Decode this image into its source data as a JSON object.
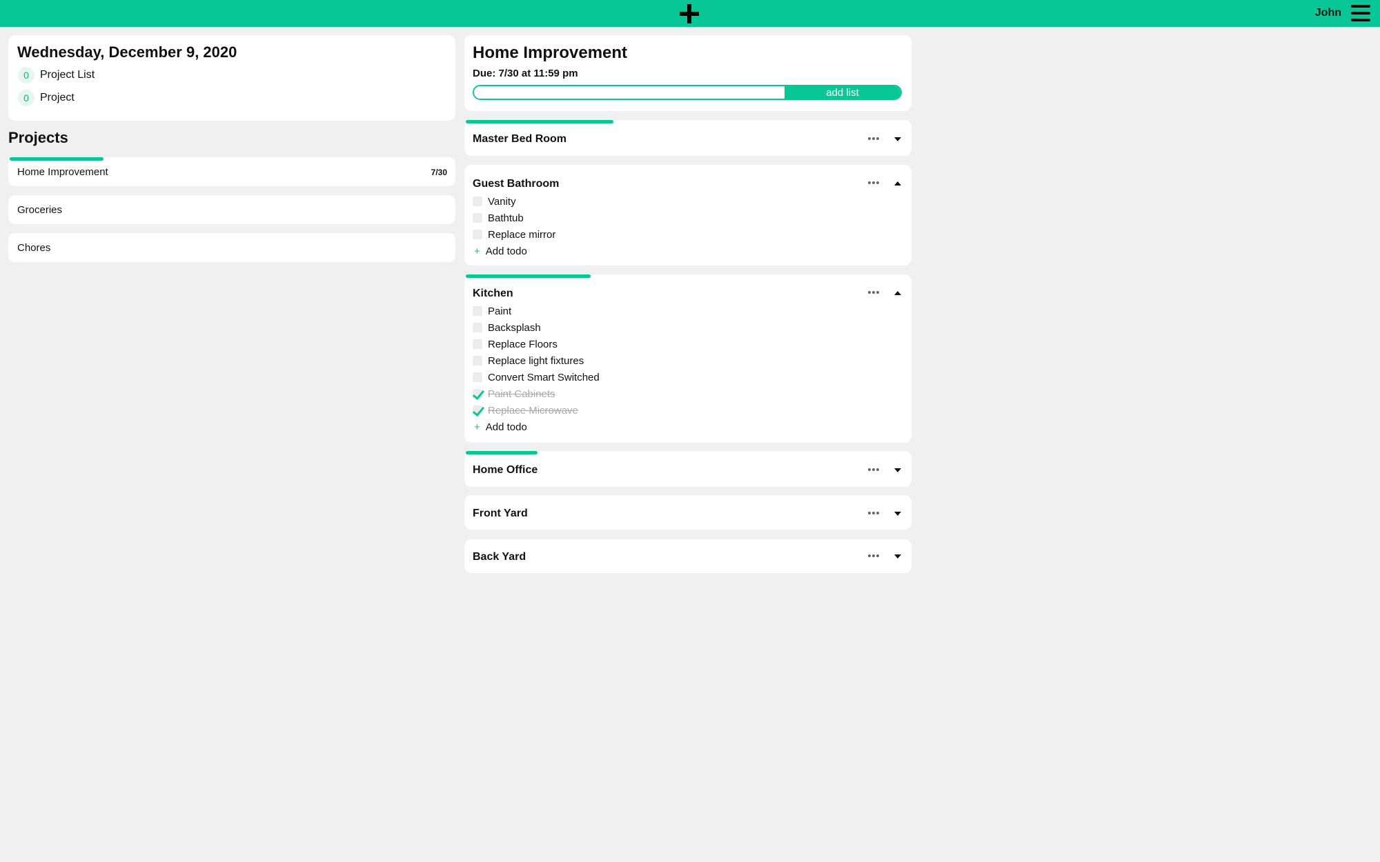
{
  "header": {
    "add_icon": "plus-icon",
    "username": "John",
    "menu_icon": "hamburger-icon",
    "accent_color": "#08c796"
  },
  "today": {
    "date": "Wednesday, December 9, 2020",
    "stats": [
      {
        "count": "0",
        "label": "Project List"
      },
      {
        "count": "0",
        "label": "Project"
      }
    ]
  },
  "projects": {
    "heading": "Projects",
    "items": [
      {
        "name": "Home Improvement",
        "due": "7/30",
        "progress": 0.21
      },
      {
        "name": "Groceries",
        "due": "",
        "progress": 0
      },
      {
        "name": "Chores",
        "due": "",
        "progress": 0
      }
    ]
  },
  "detail": {
    "title": "Home Improvement",
    "due": "Due: 7/30 at 11:59 pm",
    "add_list_value": "",
    "add_list_button": "add list"
  },
  "lists": [
    {
      "title": "Master Bed Room",
      "expanded": false,
      "progress": 0.33,
      "todos": []
    },
    {
      "title": "Guest Bathroom",
      "expanded": true,
      "progress": 0,
      "todos": [
        {
          "text": "Vanity",
          "done": false
        },
        {
          "text": "Bathtub",
          "done": false
        },
        {
          "text": "Replace mirror",
          "done": false
        }
      ]
    },
    {
      "title": "Kitchen",
      "expanded": true,
      "progress": 0.28,
      "todos": [
        {
          "text": "Paint",
          "done": false
        },
        {
          "text": "Backsplash",
          "done": false
        },
        {
          "text": "Replace Floors",
          "done": false
        },
        {
          "text": "Replace light fixtures",
          "done": false
        },
        {
          "text": "Convert Smart Switched",
          "done": false
        },
        {
          "text": "Paint Cabinets",
          "done": true
        },
        {
          "text": "Replace Microwave",
          "done": true
        }
      ]
    },
    {
      "title": "Home Office",
      "expanded": false,
      "progress": 0.16,
      "todos": []
    },
    {
      "title": "Front Yard",
      "expanded": false,
      "progress": 0,
      "todos": []
    },
    {
      "title": "Back Yard",
      "expanded": false,
      "progress": 0,
      "todos": []
    }
  ],
  "add_todo_label": "Add todo"
}
